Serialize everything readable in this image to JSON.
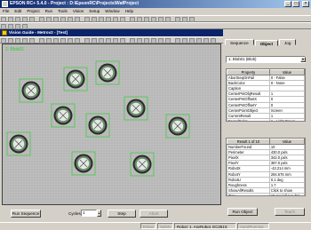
{
  "app": {
    "title": "EPSON RC+ 5.4.0 - Project : D:\\EpsonRC\\Projects\\WafProject"
  },
  "menu": [
    "File",
    "Edit",
    "Project",
    "Run",
    "Tools",
    "Vision",
    "Setup",
    "Window",
    "Help"
  ],
  "vision_guide": {
    "title": "Vision Guide - Metrov2 - [Test]",
    "image_label": "1: Blob01",
    "cycles_label": "Cycles:",
    "cycles_value": "1",
    "run_sequence": "Run Sequence",
    "step": "Step",
    "abort": "Abort"
  },
  "right_panel": {
    "tabs": [
      "Sequence",
      "Object",
      "Jog"
    ],
    "active_tab": "Object",
    "object_select": "1: Blob01 (Blob)",
    "prop_header": [
      "Property",
      "Value"
    ],
    "properties": [
      [
        "AbortSeqOnFail",
        "0 - False"
      ],
      [
        "BackColor",
        "0 - None"
      ],
      [
        "Caption",
        ""
      ],
      [
        "CenterPntObjResult",
        "1"
      ],
      [
        "CenterPntOffsetX",
        "0"
      ],
      [
        "CenterPntOffsetY",
        "0"
      ],
      [
        "CenterPointObject",
        "Screen"
      ],
      [
        "CurrentResult",
        "1"
      ],
      [
        "FoundColor",
        "1 - Light Green"
      ],
      [
        "Frame",
        "None"
      ]
    ],
    "result_header": [
      "Result 1 of 10",
      "Value"
    ],
    "results": [
      [
        "NumberFound",
        "10"
      ],
      [
        "Perimeter",
        "430.0 pxls"
      ],
      [
        "PixelX",
        "342.0 pxls"
      ],
      [
        "PixelY",
        "387.0 pxls"
      ],
      [
        "RobotX",
        "-42.214 mm"
      ],
      [
        "RobotY",
        "294.676 mm"
      ],
      [
        "RobotU",
        "0.1 deg"
      ],
      [
        "Roughness",
        "1.7"
      ],
      [
        "ShowAllResults",
        "Click to show"
      ],
      [
        "Time",
        "15 ms (all results)"
      ]
    ],
    "run_object": "Run Object",
    "teach": "Teach"
  },
  "status": [
    "EStop",
    "Safety",
    "Robot: 1, AsyRobot, EC251S",
    "Auto/Running"
  ],
  "colors": {
    "found": "#33cc33",
    "title": "#0a246a"
  }
}
